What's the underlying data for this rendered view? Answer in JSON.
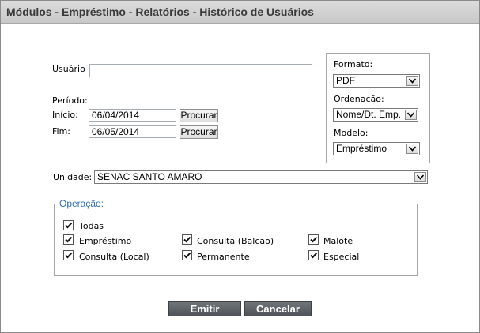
{
  "title": "Módulos - Empréstimo - Relatórios - Histórico de Usuários",
  "usuario": {
    "label": "Usuário",
    "value": ""
  },
  "periodo": {
    "label": "Período:",
    "inicio_label": "Início:",
    "inicio_value": "06/04/2014",
    "fim_label": "Fim:",
    "fim_value": "06/05/2014",
    "procurar_label": "Procurar"
  },
  "formato": {
    "label": "Formato:",
    "value": "PDF"
  },
  "ordenacao": {
    "label": "Ordenação:",
    "value": "Nome/Dt. Emp."
  },
  "modelo": {
    "label": "Modelo:",
    "value": "Empréstimo"
  },
  "unidade": {
    "label": "Unidade:",
    "value": "SENAC SANTO AMARO"
  },
  "operacao": {
    "legend": "Operação:",
    "options": [
      {
        "label": "Todas",
        "checked": true
      },
      {
        "label": "Empréstimo",
        "checked": true
      },
      {
        "label": "Consulta (Balcão)",
        "checked": true
      },
      {
        "label": "Malote",
        "checked": true
      },
      {
        "label": "Consulta (Local)",
        "checked": true
      },
      {
        "label": "Permanente",
        "checked": true
      },
      {
        "label": "Especial",
        "checked": true
      }
    ]
  },
  "actions": {
    "emitir": "Emitir",
    "cancelar": "Cancelar"
  },
  "colors": {
    "title_bg": "#cfcfcf",
    "legend": "#2f6fb7",
    "button_dark": "#5a5f63"
  }
}
